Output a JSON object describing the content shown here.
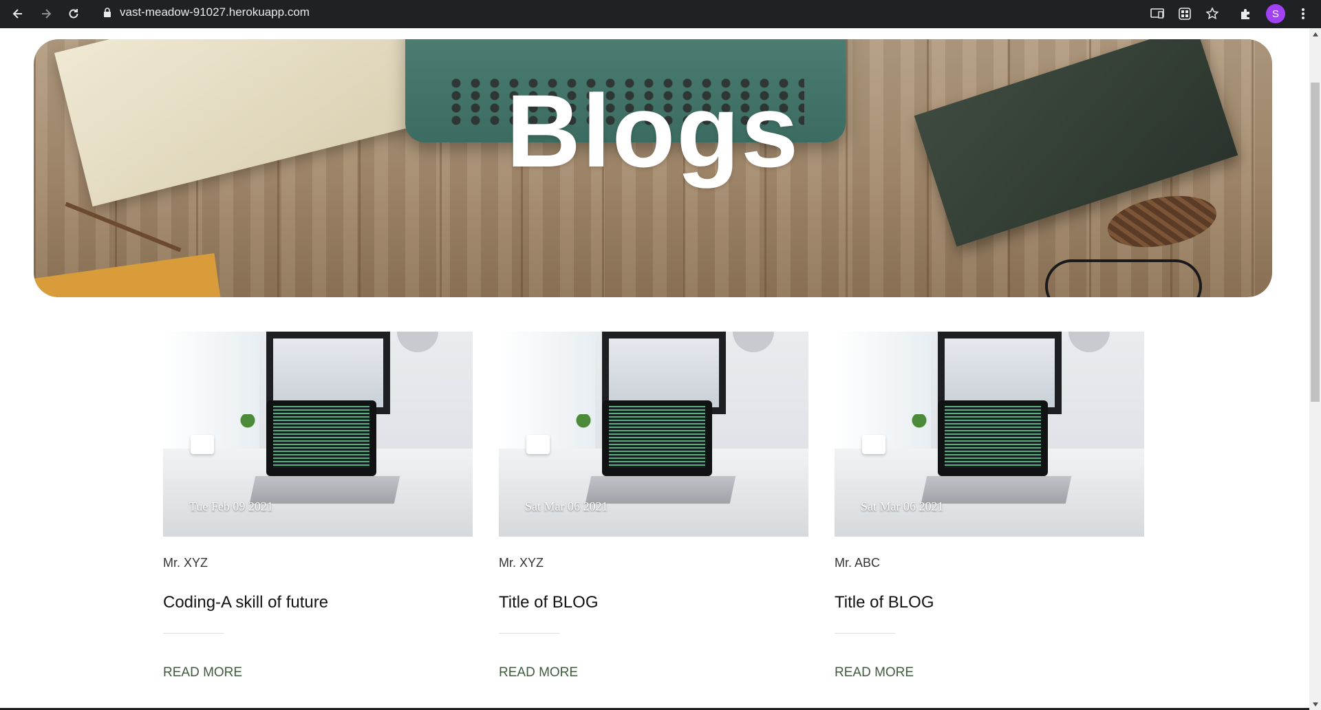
{
  "browser": {
    "url": "vast-meadow-91027.herokuapp.com",
    "profile_initial": "S",
    "icons": [
      "back-icon",
      "forward-icon",
      "reload-icon",
      "lock-icon",
      "cast-icon",
      "apps-icon",
      "star-icon",
      "extensions-icon",
      "menu-icon"
    ]
  },
  "hero": {
    "title": "Blogs"
  },
  "posts": [
    {
      "date": "Tue Feb 09 2021",
      "author": "Mr. XYZ",
      "title": "Coding-A skill of future",
      "cta": "READ MORE"
    },
    {
      "date": "Sat Mar 06 2021",
      "author": "Mr. XYZ",
      "title": "Title of BLOG",
      "cta": "READ MORE"
    },
    {
      "date": "Sat Mar 06 2021",
      "author": "Mr. ABC",
      "title": "Title of BLOG",
      "cta": "READ MORE"
    }
  ],
  "colors": {
    "chrome_bg": "#202124",
    "read_more": "#3f5a3c",
    "avatar": "#a142f4"
  }
}
